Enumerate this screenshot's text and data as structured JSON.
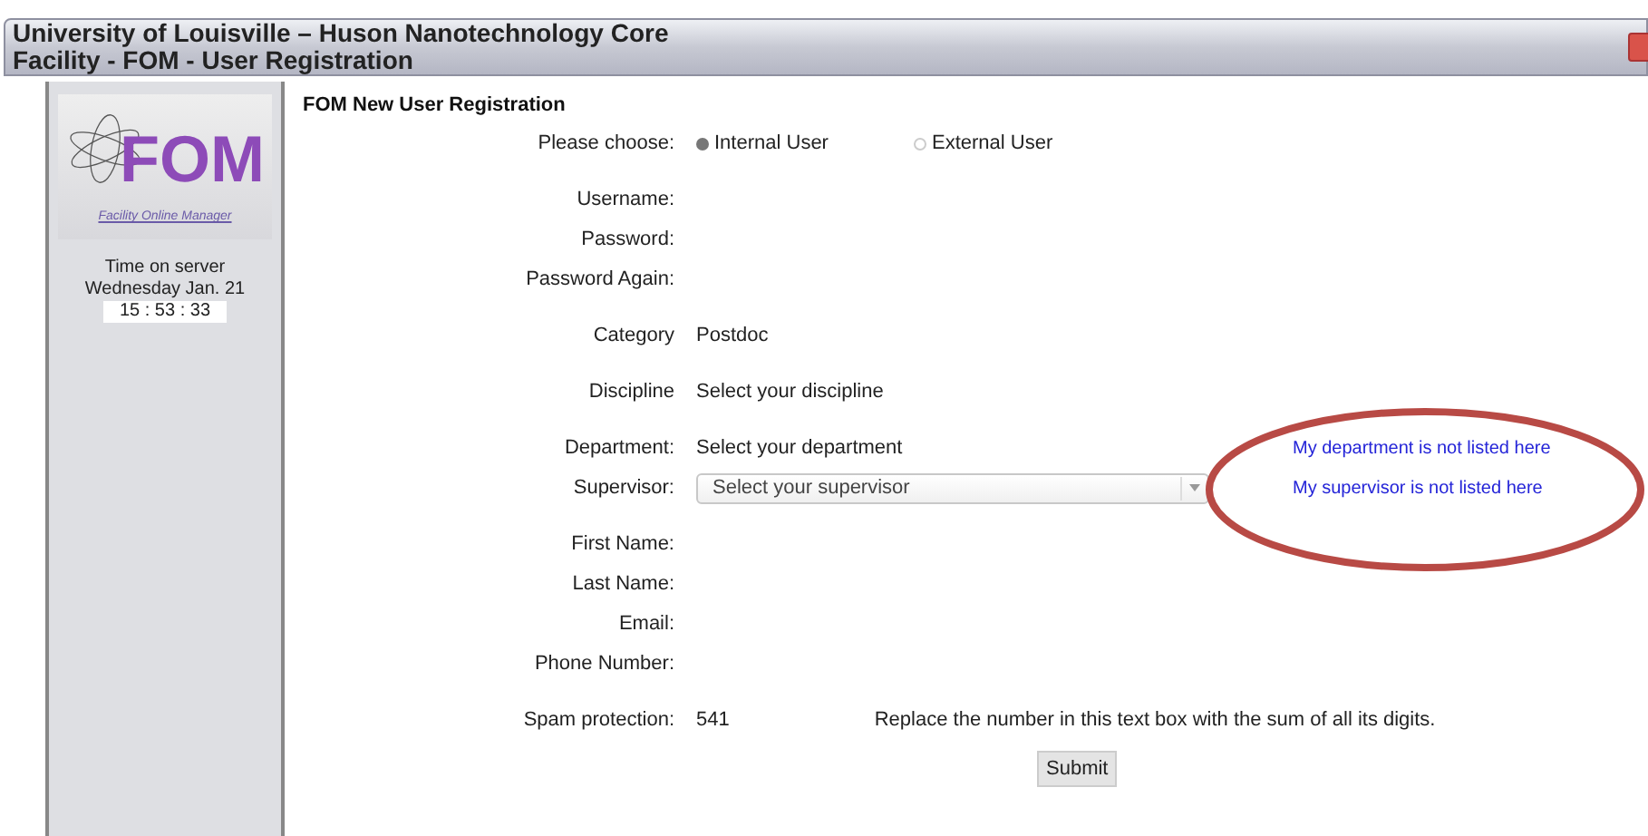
{
  "window": {
    "title_lines": [
      "University of Louisville – Huson Nanotechnology Core",
      "Facility - FOM - User Registration"
    ]
  },
  "sidebar": {
    "logo_text": "FOM",
    "logo_caption": "Facility Online Manager",
    "server_time_label": "Time on server",
    "server_date": "Wednesday Jan. 21",
    "server_clock": "15 : 53 : 33"
  },
  "form": {
    "heading": "FOM New User Registration",
    "groups": [
      [
        {
          "kind": "radio",
          "label": "Please choose:",
          "options": [
            {
              "label": "Internal User",
              "selected": true
            },
            {
              "label": "External User",
              "selected": false
            }
          ]
        }
      ],
      [
        {
          "kind": "blank",
          "label": "Username:"
        },
        {
          "kind": "blank",
          "label": "Password:"
        },
        {
          "kind": "blank",
          "label": "Password Again:"
        }
      ],
      [
        {
          "kind": "text",
          "label": "Category",
          "value": "Postdoc"
        }
      ],
      [
        {
          "kind": "text",
          "label": "Discipline",
          "value": "Select your discipline"
        }
      ],
      [
        {
          "kind": "text",
          "label": "Department:",
          "value": "Select your department",
          "link": "My department is not listed here"
        },
        {
          "kind": "select",
          "label": "Supervisor:",
          "value": "Select your supervisor",
          "link": "My supervisor is not listed here"
        }
      ],
      [
        {
          "kind": "blank",
          "label": "First Name:"
        },
        {
          "kind": "blank",
          "label": "Last Name:"
        },
        {
          "kind": "blank",
          "label": "Email:"
        },
        {
          "kind": "blank",
          "label": "Phone Number:"
        }
      ],
      [
        {
          "kind": "spam",
          "label": "Spam protection:",
          "value": "541",
          "hint": "Replace the number in this text box with the sum of all its digits."
        }
      ]
    ],
    "submit": "Submit"
  },
  "annotation": {
    "kind": "ellipse"
  }
}
